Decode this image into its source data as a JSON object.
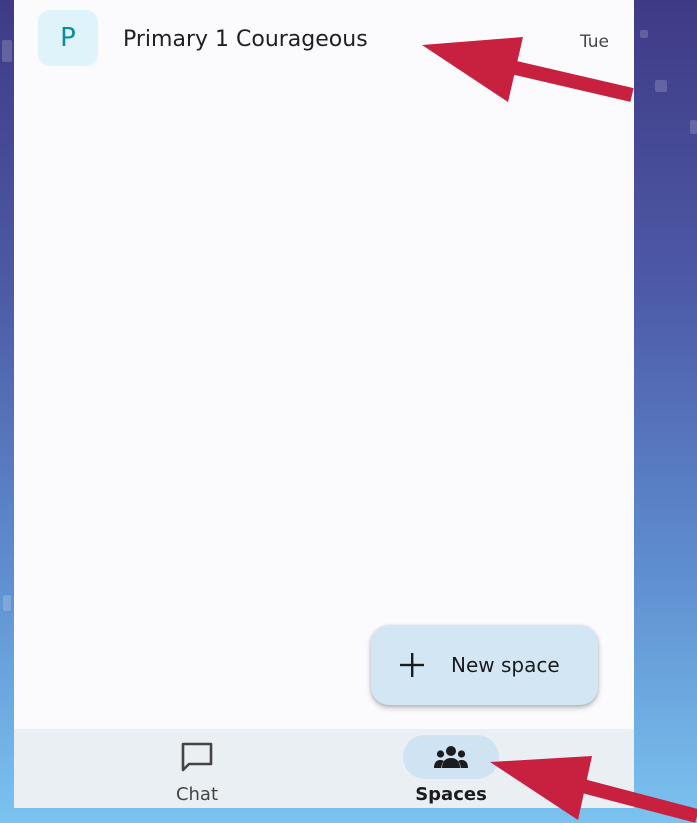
{
  "spaces_list": [
    {
      "avatar_letter": "P",
      "name": "Primary 1 Courageous",
      "time": "Tue"
    }
  ],
  "fab": {
    "label": "New space",
    "icon": "plus-icon"
  },
  "bottom_nav": {
    "items": [
      {
        "label": "Chat",
        "icon": "chat-bubble-icon",
        "selected": false
      },
      {
        "label": "Spaces",
        "icon": "people-group-icon",
        "selected": true
      }
    ]
  },
  "colors": {
    "avatar_bg": "#dff3fb",
    "avatar_text": "#0d8ba3",
    "fab_bg": "#d3e6f3",
    "nav_bg": "#eaeff4",
    "selected_pill": "#cfe3f2",
    "annotation_arrow": "#c8203f"
  }
}
